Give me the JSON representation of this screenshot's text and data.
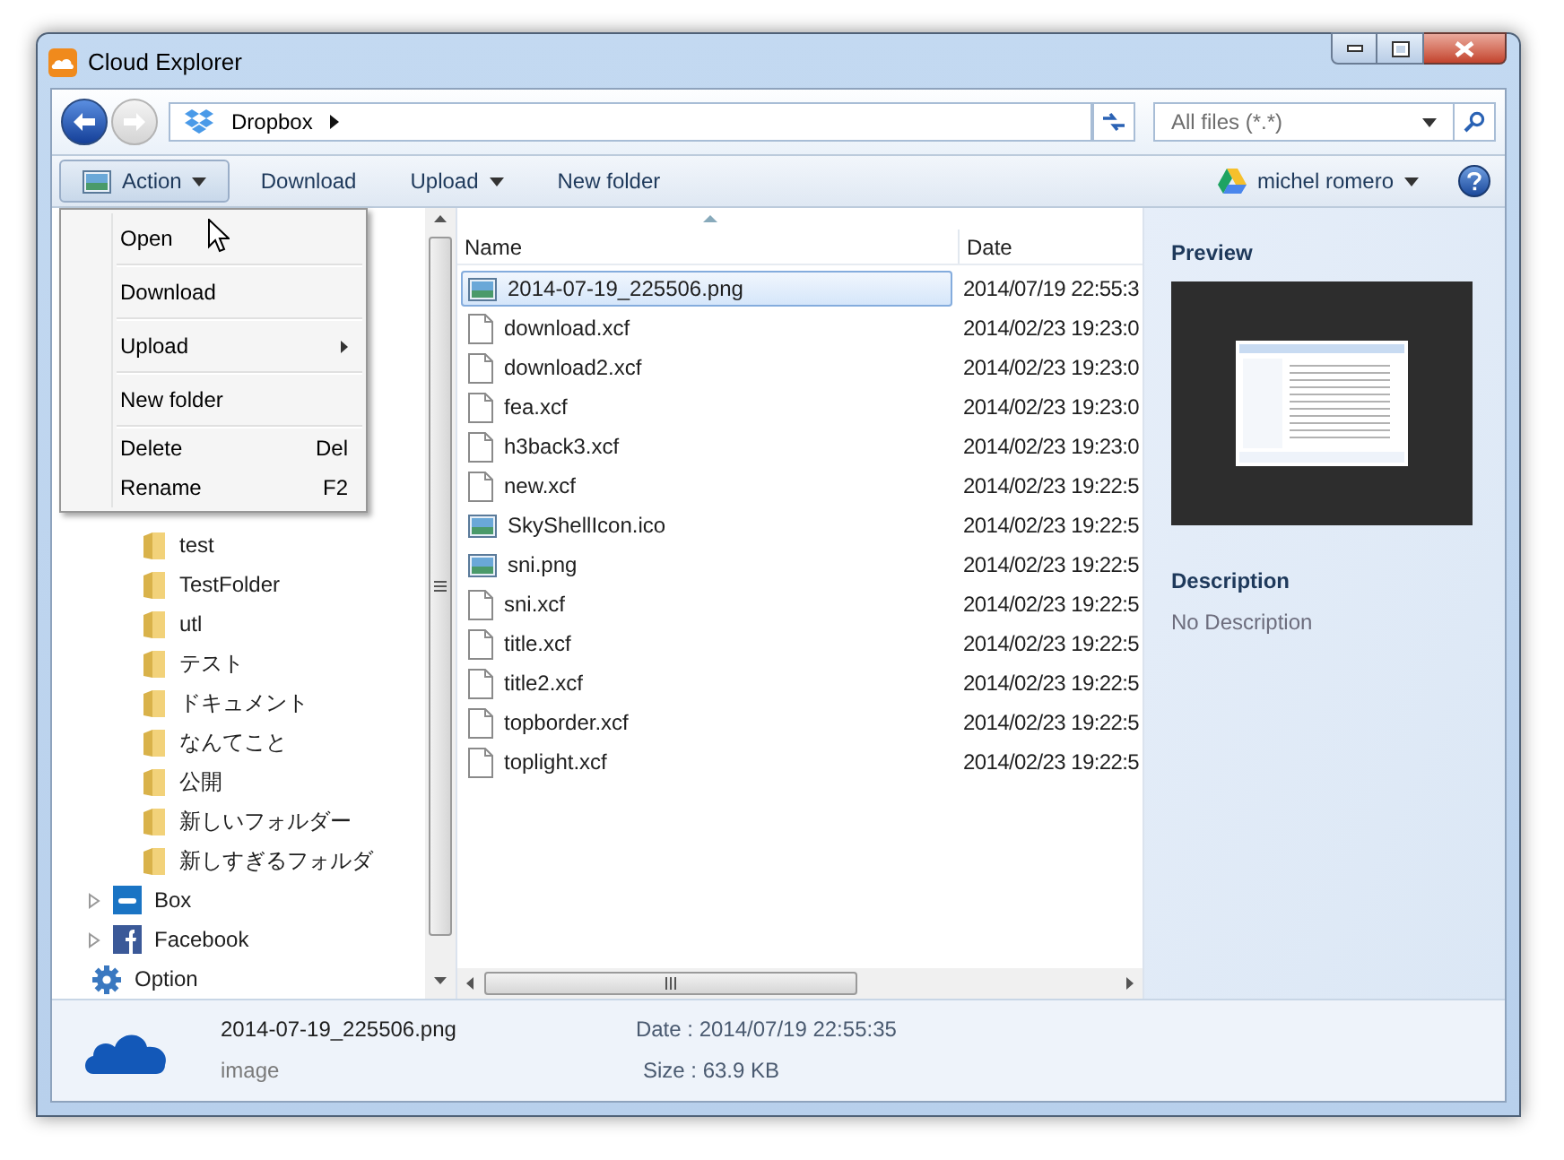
{
  "window": {
    "title": "Cloud Explorer"
  },
  "address_bar": {
    "location": "Dropbox"
  },
  "filter": {
    "value": "All files (*.*)"
  },
  "toolbar": {
    "buttons": [
      {
        "label": "Action",
        "kind": "image-menu",
        "pressed": true
      },
      {
        "label": "Download",
        "kind": "plain",
        "pressed": false
      },
      {
        "label": "Upload",
        "kind": "menu",
        "pressed": false
      },
      {
        "label": "New folder",
        "kind": "plain",
        "pressed": false
      }
    ],
    "account": "michel romero"
  },
  "action_menu": {
    "items": [
      {
        "label": "Open",
        "submenu": false,
        "divider_after": true
      },
      {
        "label": "Download",
        "submenu": false,
        "divider_after": true
      },
      {
        "label": "Upload",
        "submenu": true,
        "divider_after": true
      },
      {
        "label": "New folder",
        "submenu": false,
        "divider_after": true
      },
      {
        "label": "Delete",
        "shortcut": "Del",
        "submenu": false,
        "divider_after": false
      },
      {
        "label": "Rename",
        "shortcut": "F2",
        "submenu": false,
        "divider_after": false
      }
    ]
  },
  "sidebar": {
    "items": [
      {
        "label": "test",
        "kind": "folder"
      },
      {
        "label": "TestFolder",
        "kind": "folder"
      },
      {
        "label": "utl",
        "kind": "folder"
      },
      {
        "label": "テスト",
        "kind": "folder"
      },
      {
        "label": "ドキュメント",
        "kind": "folder"
      },
      {
        "label": "なんてこと",
        "kind": "folder"
      },
      {
        "label": "公開",
        "kind": "folder"
      },
      {
        "label": "新しいフォルダー",
        "kind": "folder"
      },
      {
        "label": "新しすぎるフォルダ",
        "kind": "folder"
      },
      {
        "label": "Box",
        "kind": "box",
        "expanded": false
      },
      {
        "label": "Facebook",
        "kind": "facebook",
        "expanded": false
      },
      {
        "label": "Option",
        "kind": "option"
      }
    ]
  },
  "file_list": {
    "columns": [
      "Name",
      "Date"
    ],
    "rows": [
      {
        "name": "2014-07-19_225506.png",
        "date": "2014/07/19 22:55:3",
        "kind": "image",
        "selected": true
      },
      {
        "name": "download.xcf",
        "date": "2014/02/23 19:23:0",
        "kind": "file",
        "selected": false
      },
      {
        "name": "download2.xcf",
        "date": "2014/02/23 19:23:0",
        "kind": "file",
        "selected": false
      },
      {
        "name": "fea.xcf",
        "date": "2014/02/23 19:23:0",
        "kind": "file",
        "selected": false
      },
      {
        "name": "h3back3.xcf",
        "date": "2014/02/23 19:23:0",
        "kind": "file",
        "selected": false
      },
      {
        "name": "new.xcf",
        "date": "2014/02/23 19:22:5",
        "kind": "file",
        "selected": false
      },
      {
        "name": "SkyShellIcon.ico",
        "date": "2014/02/23 19:22:5",
        "kind": "image",
        "selected": false
      },
      {
        "name": "sni.png",
        "date": "2014/02/23 19:22:5",
        "kind": "image",
        "selected": false
      },
      {
        "name": "sni.xcf",
        "date": "2014/02/23 19:22:5",
        "kind": "file",
        "selected": false
      },
      {
        "name": "title.xcf",
        "date": "2014/02/23 19:22:5",
        "kind": "file",
        "selected": false
      },
      {
        "name": "title2.xcf",
        "date": "2014/02/23 19:22:5",
        "kind": "file",
        "selected": false
      },
      {
        "name": "topborder.xcf",
        "date": "2014/02/23 19:22:5",
        "kind": "file",
        "selected": false
      },
      {
        "name": "toplight.xcf",
        "date": "2014/02/23 19:22:5",
        "kind": "file",
        "selected": false
      }
    ]
  },
  "preview_pane": {
    "preview_heading": "Preview",
    "description_heading": "Description",
    "description": "No Description"
  },
  "status_bar": {
    "file_name": "2014-07-19_225506.png",
    "file_type": "image",
    "date": "Date : 2014/07/19 22:55:35",
    "size": "Size : 63.9 KB"
  }
}
